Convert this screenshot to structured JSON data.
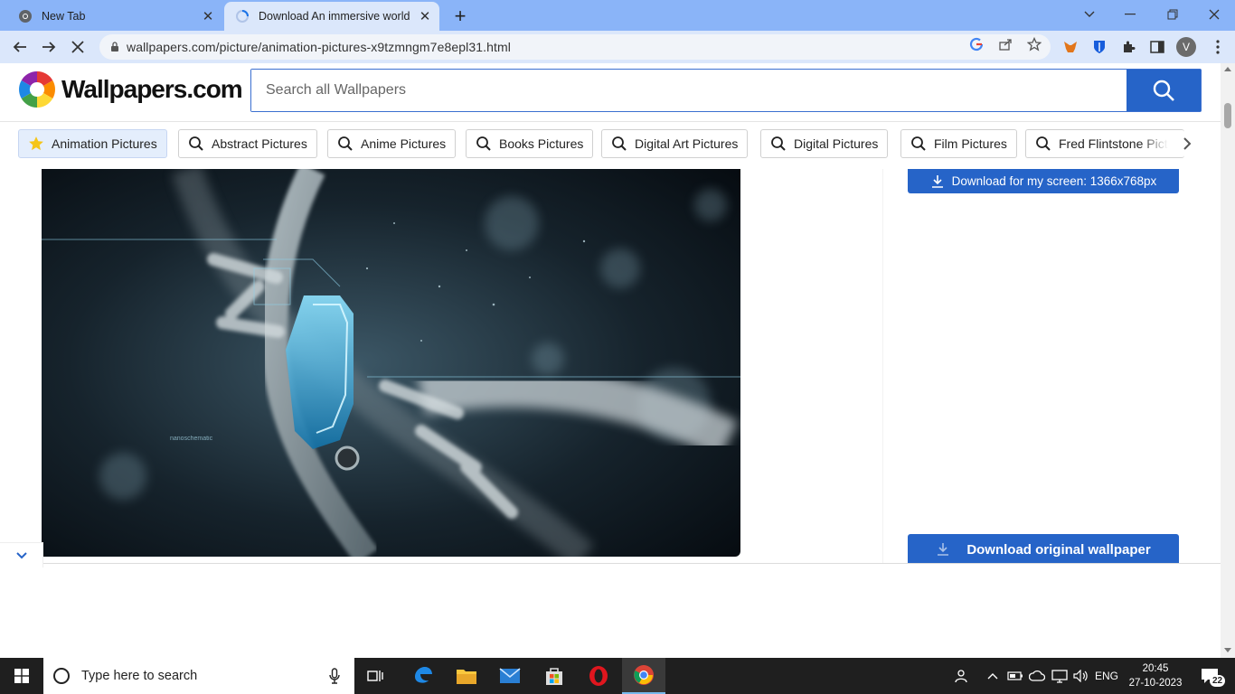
{
  "browser": {
    "tabs": [
      {
        "title": "New Tab",
        "active": false
      },
      {
        "title": "Download An immersive world o",
        "active": true
      }
    ],
    "url": "wallpapers.com/picture/animation-pictures-x9tzmngm7e8epl31.html",
    "profile_initial": "V"
  },
  "site": {
    "brand": "Wallpapers.com",
    "search_placeholder": "Search all Wallpapers",
    "chips": [
      {
        "label": "Animation Pictures",
        "icon": "star-icon",
        "active": true
      },
      {
        "label": "Abstract Pictures",
        "icon": "search-icon"
      },
      {
        "label": "Anime Pictures",
        "icon": "search-icon"
      },
      {
        "label": "Books Pictures",
        "icon": "search-icon"
      },
      {
        "label": "Digital Art Pictures",
        "icon": "search-icon"
      },
      {
        "label": "Digital Pictures",
        "icon": "search-icon"
      },
      {
        "label": "Film Pictures",
        "icon": "search-icon"
      },
      {
        "label": "Fred Flintstone Pict",
        "icon": "search-icon"
      }
    ],
    "download_screen_label": "Download for my screen: 1366x768px",
    "download_original_label": "Download original wallpaper",
    "image_caption_text": "nanoschematic"
  },
  "taskbar": {
    "search_placeholder": "Type here to search",
    "language": "ENG",
    "time": "20:45",
    "date": "27-10-2023",
    "notification_count": "22"
  },
  "colors": {
    "accent": "#2664c8",
    "tabstrip": "#8ab4f8",
    "toolbar": "#dbe7fb",
    "taskbar": "#1f1f1f"
  }
}
